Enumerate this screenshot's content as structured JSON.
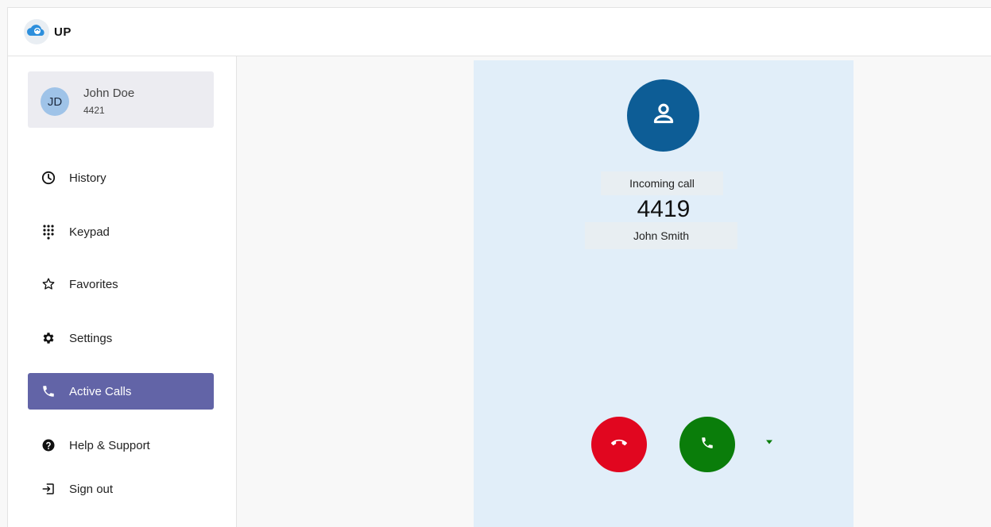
{
  "app": {
    "logo_text": "UP",
    "brand_color": "#2d8fdc"
  },
  "user": {
    "initials": "JD",
    "name": "John Doe",
    "extension": "4421"
  },
  "nav": {
    "items": [
      {
        "label": "History",
        "icon": "clock-icon"
      },
      {
        "label": "Keypad",
        "icon": "keypad-icon"
      },
      {
        "label": "Favorites",
        "icon": "star-icon"
      },
      {
        "label": "Settings",
        "icon": "gear-icon"
      },
      {
        "label": "Active Calls",
        "icon": "phone-icon",
        "active": true
      },
      {
        "label": "Help & Support",
        "icon": "help-icon"
      },
      {
        "label": "Sign out",
        "icon": "sign-out-icon"
      }
    ],
    "active_color": "#6264a7"
  },
  "call": {
    "status_label": "Incoming call",
    "number": "4419",
    "caller_name": "John Smith",
    "decline_color": "#e1061f",
    "accept_color": "#0a7d0a",
    "panel_color": "#e1eef9"
  }
}
